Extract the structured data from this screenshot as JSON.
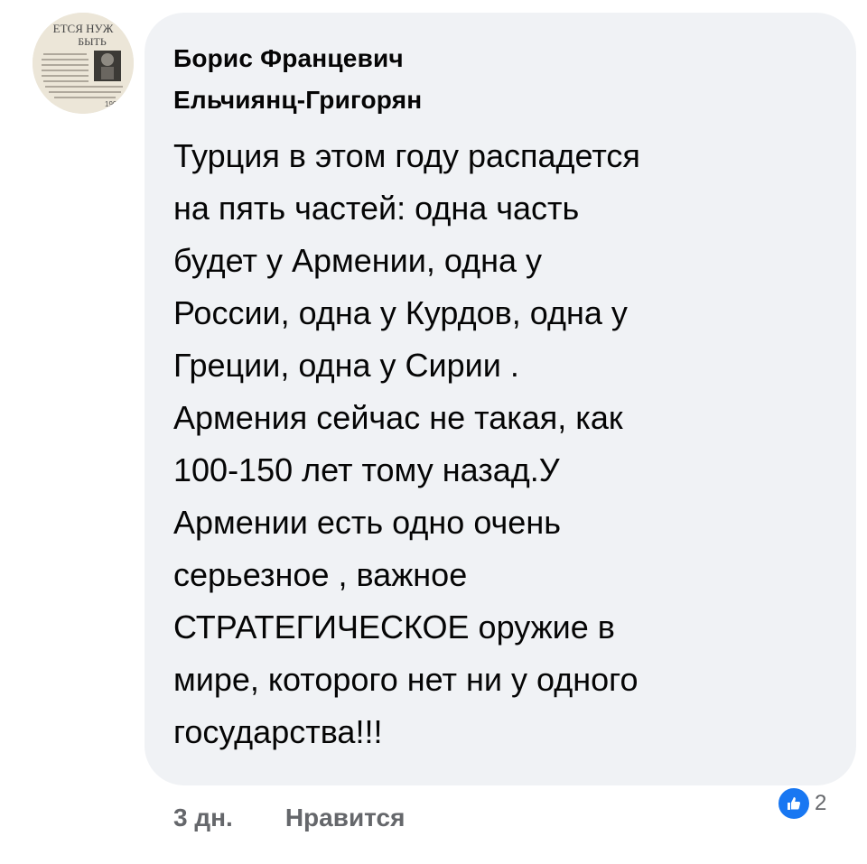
{
  "comment": {
    "author": "Борис Францевич\nЕльчиянц-Григорян",
    "text": "Турция  в этом году распадется\nна пять частей: одна часть\nбудет у Армении, одна у\nРоссии, одна у Курдов, одна у\nГреции, одна у Сирии .\n Армения сейчас не такая, как\n100-150 лет тому назад.У\nАрмении есть одно очень\nсерьезное , важное\nСТРАТЕГИЧЕСКОЕ оружие в\nмире, которого нет ни у одного\nгосударства!!!",
    "time": "3 дн.",
    "like_label": "Нравится",
    "reaction_count": "2"
  },
  "avatar": {
    "headline": "ЕТСЯ НУЖ БЫТЬ",
    "corner_text": "1995"
  },
  "colors": {
    "bubble": "#f0f2f5",
    "text": "#050505",
    "secondary": "#65676b",
    "like_blue": "#1877f2"
  },
  "icons": {
    "reaction": "thumbs-up-icon"
  }
}
